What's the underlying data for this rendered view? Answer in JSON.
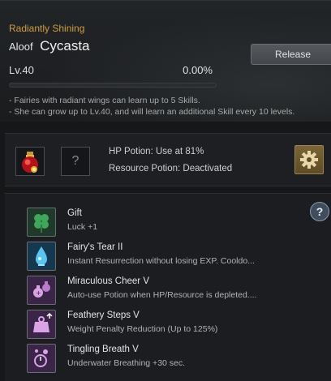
{
  "pet": {
    "grade": "Radiantly Shining",
    "trait": "Aloof",
    "name": "Cycasta",
    "level": "Lv.40",
    "exp": "0.00%",
    "exp_fraction": 0.0,
    "release_label": "Release",
    "desc_line1": "- Fairies with radiant wings can learn up to 5 Skills.",
    "desc_line2": "- She can grow up to Lv.40, and will learn an additional Skill every 10 levels."
  },
  "potion": {
    "empty_slot_label": "?",
    "hp_setting": "HP Potion: Use at 81%",
    "resource_setting": "Resource Potion: Deactivated"
  },
  "help_label": "?",
  "skills": [
    {
      "name": "Gift",
      "desc": "Luck +1",
      "icon": "clover-icon"
    },
    {
      "name": "Fairy's Tear II",
      "desc": "Instant Resurrection without losing EXP. Cooldo...",
      "icon": "tear-icon"
    },
    {
      "name": "Miraculous Cheer V",
      "desc": "Auto-use Potion when HP/Resource is depleted....",
      "icon": "potion-cheer-icon"
    },
    {
      "name": "Feathery Steps V",
      "desc": "Weight Penalty Reduction (Up to 125%)",
      "icon": "weight-icon"
    },
    {
      "name": "Tingling Breath V",
      "desc": "Underwater Breathing +30 sec.",
      "icon": "breath-icon"
    }
  ],
  "colors": {
    "grade": "#d19c3f",
    "gear_button": "#6b5a2e",
    "background": "#151719"
  }
}
